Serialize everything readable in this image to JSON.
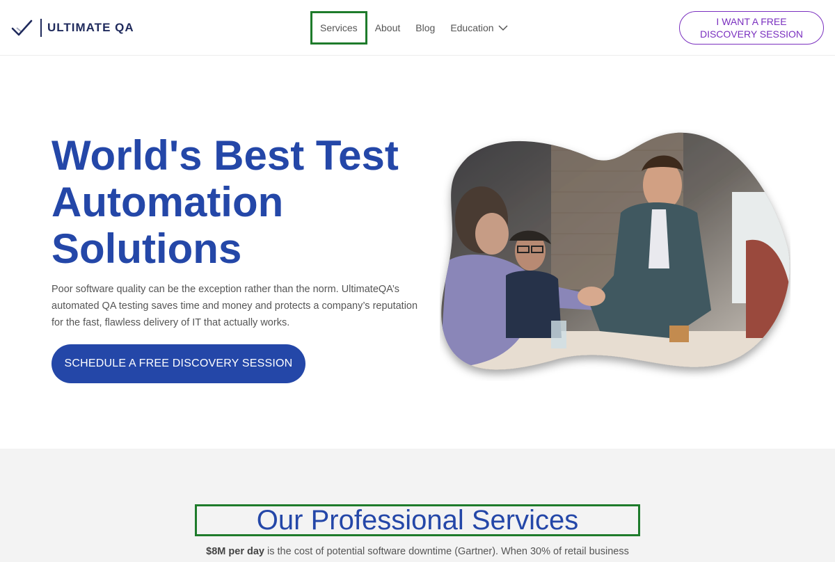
{
  "header": {
    "logo_text": "ULTIMATE QA",
    "nav": [
      {
        "label": "Services"
      },
      {
        "label": "About"
      },
      {
        "label": "Blog"
      },
      {
        "label": "Education"
      }
    ],
    "cta_label": "I WANT A FREE DISCOVERY SESSION"
  },
  "hero": {
    "title": "World's Best Test Automation Solutions",
    "paragraph": "Poor software quality can be the exception rather than the norm. UltimateQA’s automated QA testing saves time and money and protects a company’s reputation for the fast, flawless delivery of IT that actually works.",
    "button_label": "SCHEDULE A FREE DISCOVERY SESSION"
  },
  "services": {
    "title": "Our Professional Services",
    "intro_bold": "$8M per day",
    "intro_rest": " is the cost of potential software downtime (Gartner). When 30% of retail business"
  },
  "colors": {
    "brand_blue": "#2447a8",
    "cta_purple": "#7a2fbf",
    "highlight_green": "#1e7b2b",
    "section_bg": "#f3f3f3"
  }
}
